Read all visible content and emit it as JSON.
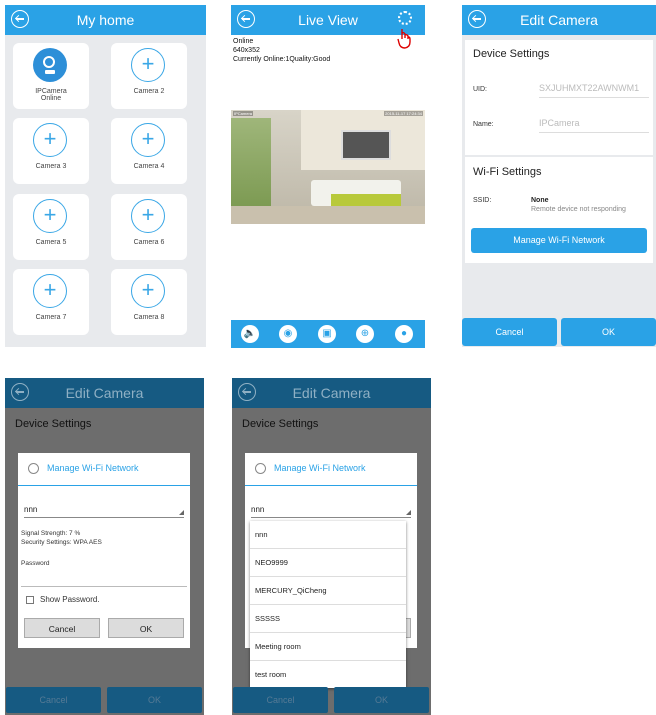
{
  "s1": {
    "title": "My home",
    "camera1": {
      "name": "IPCamera",
      "status": "Online"
    },
    "cameras": [
      "Camera 2",
      "Camera 3",
      "Camera 4",
      "Camera 5",
      "Camera 6",
      "Camera 7",
      "Camera 8"
    ],
    "plus": "+"
  },
  "s2": {
    "title": "Live View",
    "status": "Online",
    "resolution": "640x352",
    "online_quality": "Currently Online:1Quality:Good",
    "video_label_left": "IPCamera",
    "video_label_right": "2015-11-17 17:24:34",
    "toolbar_icons": [
      "speaker-icon",
      "camera-icon",
      "image-icon",
      "target-icon",
      "bulb-icon"
    ]
  },
  "s3": {
    "title": "Edit Camera",
    "device_settings": "Device Settings",
    "uid_label": "UID:",
    "uid_value": "SXJUHMXT22AWNWM1",
    "name_label": "Name:",
    "name_value": "IPCamera",
    "wifi_settings": "Wi-Fi Settings",
    "ssid_label": "SSID:",
    "ssid_value": "None",
    "ssid_note": "Remote device not responding",
    "manage_btn": "Manage Wi-Fi Network",
    "cancel": "Cancel",
    "ok": "OK"
  },
  "s4": {
    "title": "Edit Camera",
    "device_settings": "Device Settings",
    "dialog_title": "Manage Wi-Fi Network",
    "selected_network": "nnn",
    "signal": "Signal Strength: 7 %",
    "security": "Security Settings: WPA AES",
    "password_label": "Password",
    "show_password": "Show Password.",
    "cancel": "Cancel",
    "ok": "OK",
    "bottom_cancel": "Cancel",
    "bottom_ok": "OK"
  },
  "s5": {
    "title": "Edit Camera",
    "device_settings": "Device Settings",
    "dialog_title": "Manage Wi-Fi Network",
    "selected_network": "nnn",
    "networks": [
      "nnn",
      "NEO9999",
      "MERCURY_QiCheng",
      "SSSSS",
      "Meeting room",
      "test room"
    ],
    "bottom_cancel": "Cancel",
    "bottom_ok": "OK"
  },
  "colors": {
    "accent": "#2aa2e6",
    "dim_bar": "#165a82",
    "overlay": "#6d6d6d"
  }
}
